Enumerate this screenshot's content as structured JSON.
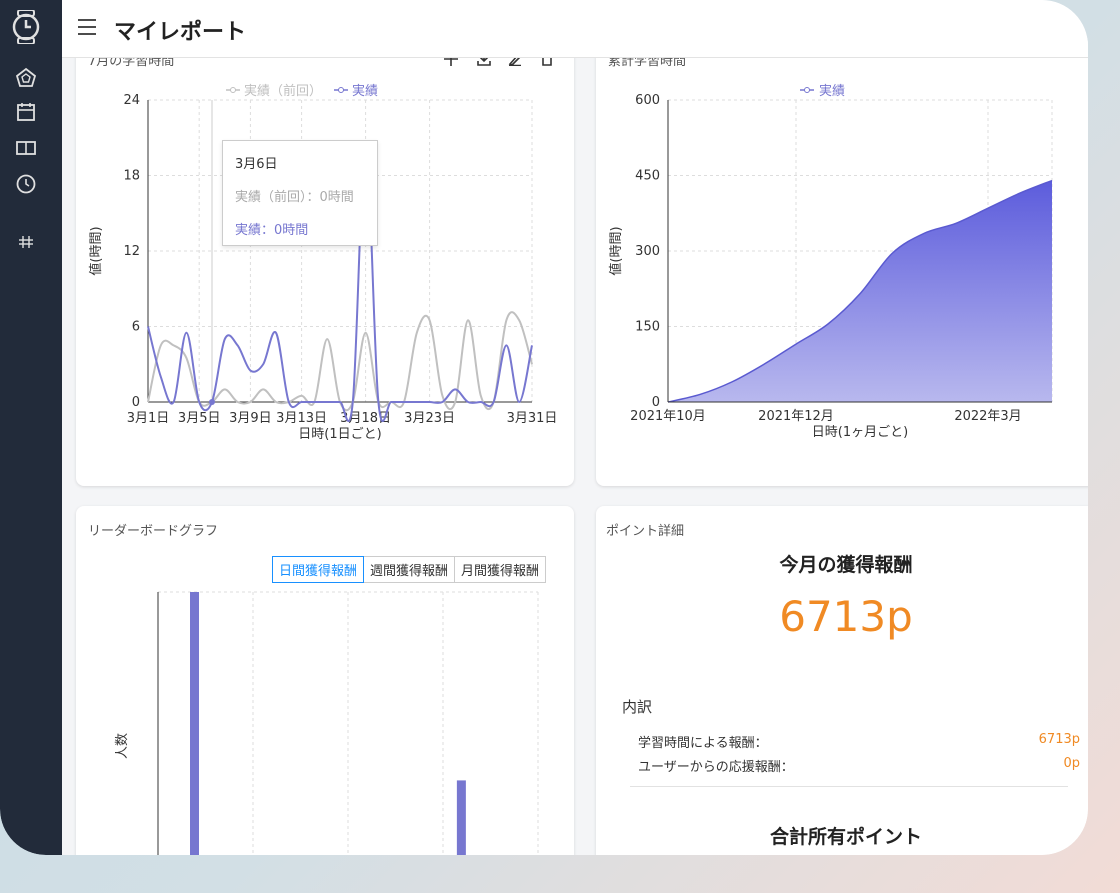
{
  "app": {
    "title": "マイレポート"
  },
  "sidebar": {
    "items": [
      {
        "icon": "watch-icon"
      },
      {
        "icon": "pentagon-icon"
      },
      {
        "icon": "calendar-icon"
      },
      {
        "icon": "book-icon"
      },
      {
        "icon": "clock-icon"
      },
      {
        "icon": "hash-icon"
      }
    ]
  },
  "cards": {
    "monthly": {
      "title": "7月の学習時間"
    },
    "cumulative": {
      "title": "累計学習時間"
    },
    "leaderboard": {
      "title": "リーダーボードグラフ",
      "tabs": [
        "日間獲得報酬",
        "週間獲得報酬",
        "月間獲得報酬"
      ],
      "active_tab": 0
    },
    "points": {
      "title": "ポイント詳細",
      "heading": "今月の獲得報酬",
      "amount": "6713p",
      "breakdown_title": "内訳",
      "rows": [
        {
          "label": "学習時間による報酬：",
          "value": "6713p"
        },
        {
          "label": "ユーザーからの応援報酬：",
          "value": "0p"
        }
      ],
      "total_heading": "合計所有ポイント"
    }
  },
  "tooltip": {
    "date": "3月6日",
    "prev": "実績（前回）：0時間",
    "curr": "実績：0時間"
  },
  "colors": {
    "series_current": "#7777d0",
    "series_prev": "#c0c0c0",
    "accent": "#f08a24",
    "tab_active": "#1890ff"
  },
  "chart_data": [
    {
      "type": "line",
      "title": "7月の学習時間",
      "xlabel": "日時(1日ごと)",
      "ylabel": "値(時間)",
      "ylim": [
        0,
        24
      ],
      "yticks": [
        0,
        6,
        12,
        18,
        24
      ],
      "xticks": [
        "3月1日",
        "3月5日",
        "3月9日",
        "3月13日",
        "3月18日",
        "3月23日",
        "3月31日"
      ],
      "legend": "top-center",
      "grid": true,
      "x": [
        1,
        2,
        3,
        4,
        5,
        6,
        7,
        8,
        9,
        10,
        11,
        12,
        13,
        14,
        15,
        16,
        17,
        18,
        19,
        20,
        21,
        22,
        23,
        24,
        25,
        26,
        27,
        28,
        29,
        30,
        31
      ],
      "series": [
        {
          "name": "実績（前回）",
          "values": [
            0,
            4.5,
            4.5,
            3.5,
            0,
            0,
            1,
            0,
            0,
            1,
            0,
            0,
            0.5,
            0,
            5,
            0,
            0,
            5.5,
            0,
            0,
            0,
            5.5,
            6.5,
            0.5,
            0,
            6.5,
            0.5,
            0,
            6.5,
            6.5,
            3
          ]
        },
        {
          "name": "実績",
          "values": [
            6,
            2,
            0,
            5.5,
            0,
            0,
            5,
            4.5,
            2.5,
            3,
            5.5,
            0,
            0,
            0,
            0,
            0,
            0,
            20.5,
            0,
            0,
            0,
            0,
            0,
            0,
            1,
            0,
            0,
            0,
            4.5,
            0,
            4.5
          ]
        }
      ]
    },
    {
      "type": "area",
      "title": "累計学習時間",
      "xlabel": "日時(1ヶ月ごと)",
      "ylabel": "値(時間)",
      "ylim": [
        0,
        600
      ],
      "yticks": [
        0,
        150,
        300,
        450,
        600
      ],
      "xticks": [
        "2021年10月",
        "2021年12月",
        "2022年3月"
      ],
      "legend": "top-center",
      "grid": true,
      "x": [
        0,
        0.5,
        1,
        1.5,
        2,
        2.5,
        3,
        3.5,
        4,
        4.5,
        5,
        5.5,
        6
      ],
      "series": [
        {
          "name": "実績",
          "values": [
            0,
            15,
            40,
            75,
            115,
            155,
            215,
            295,
            335,
            355,
            385,
            415,
            440
          ]
        }
      ]
    },
    {
      "type": "bar",
      "title": "リーダーボードグラフ",
      "ylabel": "人数",
      "grid": true,
      "values": [
        100,
        0,
        0,
        0,
        0,
        0,
        0,
        40,
        0,
        0
      ]
    }
  ]
}
